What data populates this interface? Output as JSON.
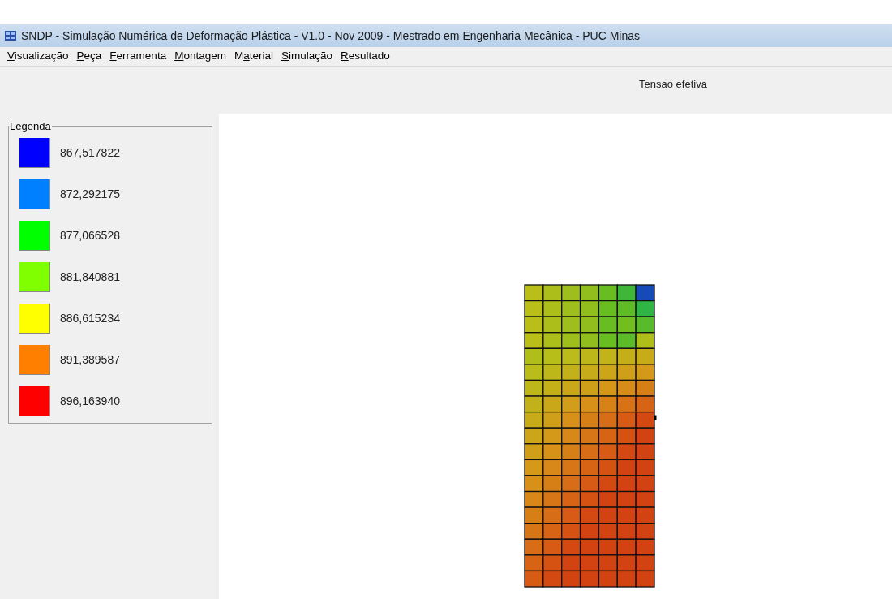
{
  "window": {
    "title": "SNDP - Simulação Numérica de Deformação Plástica - V1.0 - Nov 2009 - Mestrado em Engenharia Mecânica - PUC Minas"
  },
  "menu": [
    {
      "key": "V",
      "after": "isualização"
    },
    {
      "key": "P",
      "after": "eça"
    },
    {
      "key": "F",
      "after": "erramenta"
    },
    {
      "key": "M",
      "after": "ontagem"
    },
    {
      "before": "M",
      "key": "a",
      "after": "terial"
    },
    {
      "key": "S",
      "after": "imulação"
    },
    {
      "key": "R",
      "after": "esultado"
    }
  ],
  "plot_title": "Tensao efetiva",
  "legend": {
    "title": "Legenda",
    "items": [
      {
        "value": "867,517822",
        "color": "#0000ff"
      },
      {
        "value": "872,292175",
        "color": "#0080ff"
      },
      {
        "value": "877,066528",
        "color": "#00ff00"
      },
      {
        "value": "881,840881",
        "color": "#80ff00"
      },
      {
        "value": "886,615234",
        "color": "#ffff00"
      },
      {
        "value": "891,389587",
        "color": "#ff8000"
      },
      {
        "value": "896,163940",
        "color": "#ff0000"
      }
    ]
  }
}
